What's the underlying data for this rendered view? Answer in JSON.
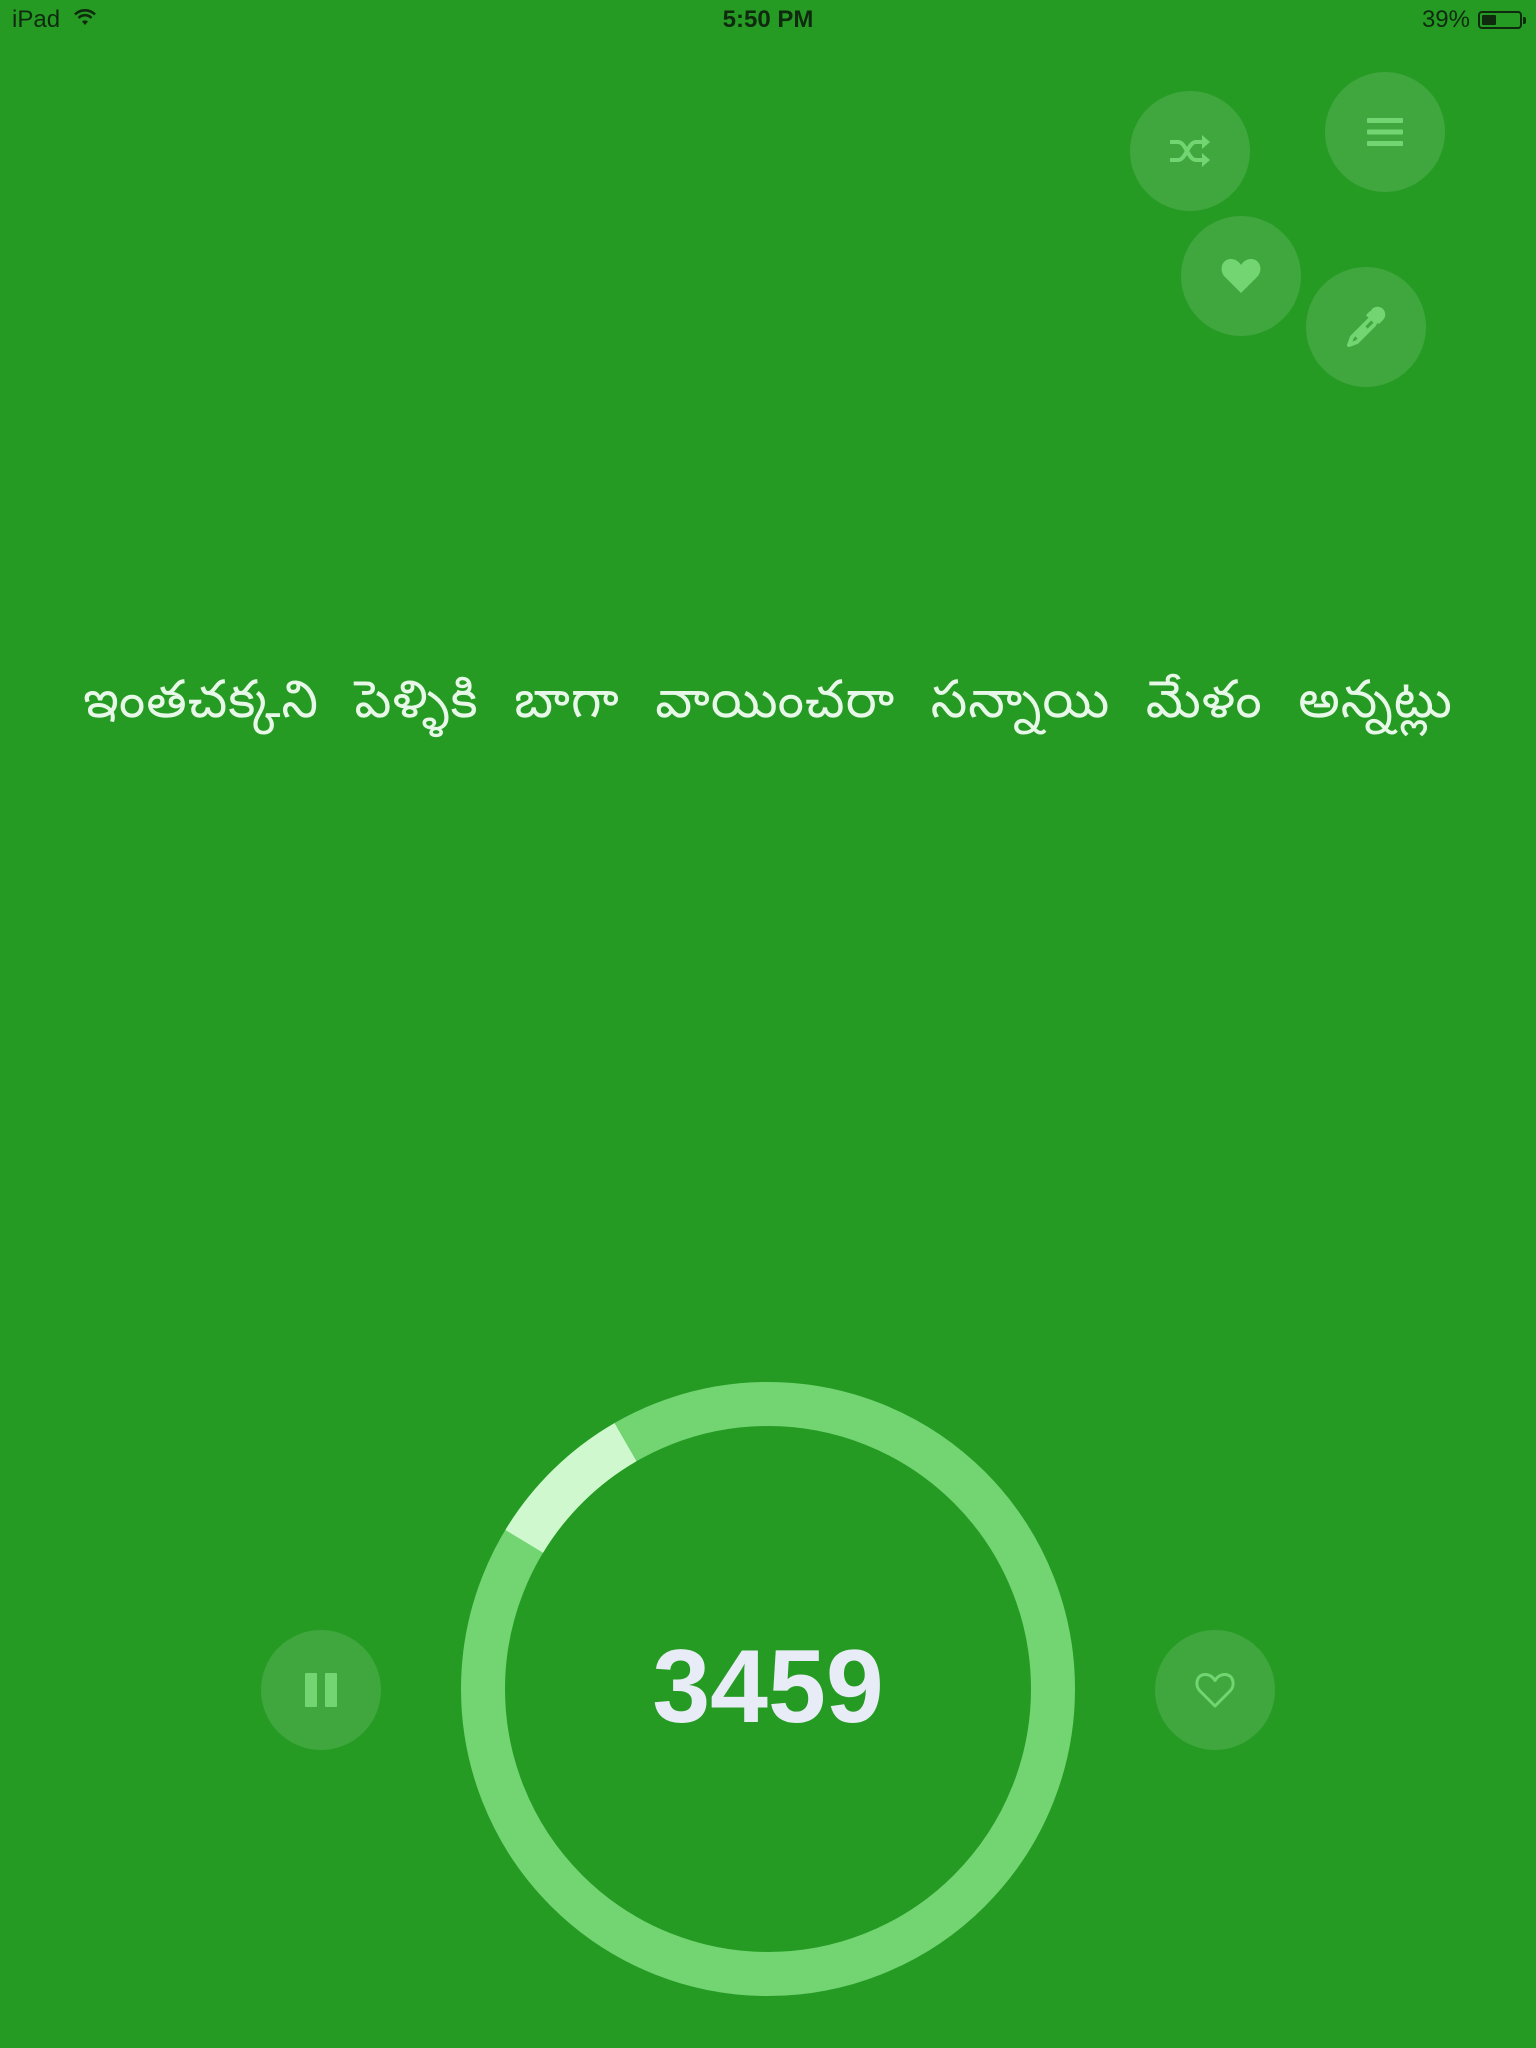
{
  "status_bar": {
    "device": "iPad",
    "time": "5:50 PM",
    "battery": "39%"
  },
  "toolbar": {
    "shuffle_icon": "shuffle-icon",
    "menu_icon": "menu-icon",
    "favorite_icon": "heart-filled-icon",
    "color_picker_icon": "eyedropper-icon"
  },
  "main": {
    "quote": "ఇంతచక్కని పెళ్ళికి బాగా వాయించరా సన్నాయి మేళం అన్నట్లు"
  },
  "timer": {
    "count": "3459",
    "progress": 0.08
  },
  "controls": {
    "pause_icon": "pause-icon",
    "like_icon": "heart-outline-icon"
  },
  "colors": {
    "background": "#259b24",
    "ring_track": "#72d572",
    "ring_progress": "#d0f8ce",
    "icon": "#72d572"
  }
}
